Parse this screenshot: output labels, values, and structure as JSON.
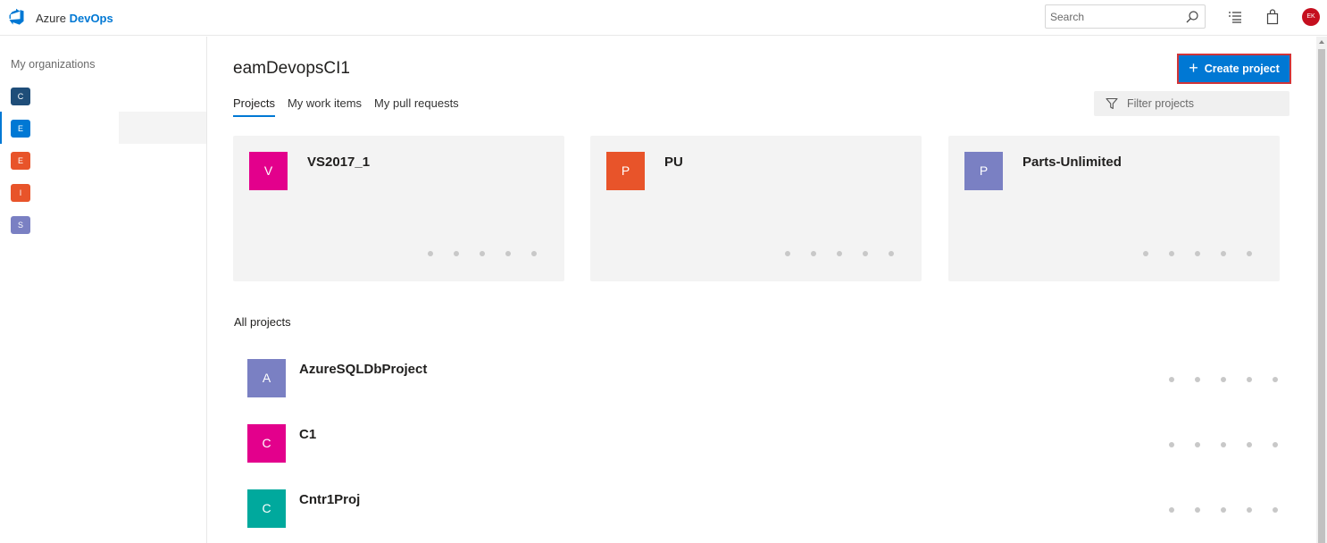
{
  "header": {
    "brand_prefix": "Azure",
    "brand_name": "DevOps",
    "search_placeholder": "Search",
    "user_initials": "EK",
    "icons": [
      "azure-devops-logo-icon",
      "search-icon",
      "work-items-list-icon",
      "shopping-bag-icon"
    ]
  },
  "sidebar": {
    "title": "My organizations",
    "orgs": [
      {
        "letter": "C",
        "color": "#1f4e79"
      },
      {
        "letter": "E",
        "color": "#0078d4"
      },
      {
        "letter": "E",
        "color": "#e8542a"
      },
      {
        "letter": "I",
        "color": "#e8542a"
      },
      {
        "letter": "S",
        "color": "#7a80c3"
      }
    ]
  },
  "main": {
    "org_name": "eamDevopsCI1",
    "create_button": "Create project",
    "tabs": [
      {
        "label": "Projects",
        "active": true
      },
      {
        "label": "My work items",
        "active": false
      },
      {
        "label": "My pull requests",
        "active": false
      }
    ],
    "filter_placeholder": "Filter projects",
    "recent_projects": [
      {
        "letter": "V",
        "name": "VS2017_1",
        "color": "#e3008c"
      },
      {
        "letter": "P",
        "name": "PU",
        "color": "#e8542a"
      },
      {
        "letter": "P",
        "name": "Parts-Unlimited",
        "color": "#7a80c3"
      }
    ],
    "all_projects_title": "All projects",
    "all_projects": [
      {
        "letter": "A",
        "name": "AzureSQLDbProject",
        "color": "#7a80c3"
      },
      {
        "letter": "C",
        "name": "C1",
        "color": "#e3008c"
      },
      {
        "letter": "C",
        "name": "Cntr1Proj",
        "color": "#00a99d"
      }
    ]
  },
  "colors": {
    "accent": "#0078d4",
    "highlight_border": "#d13438",
    "user_avatar": "#c50f1f",
    "card_bg": "#f3f3f3"
  }
}
